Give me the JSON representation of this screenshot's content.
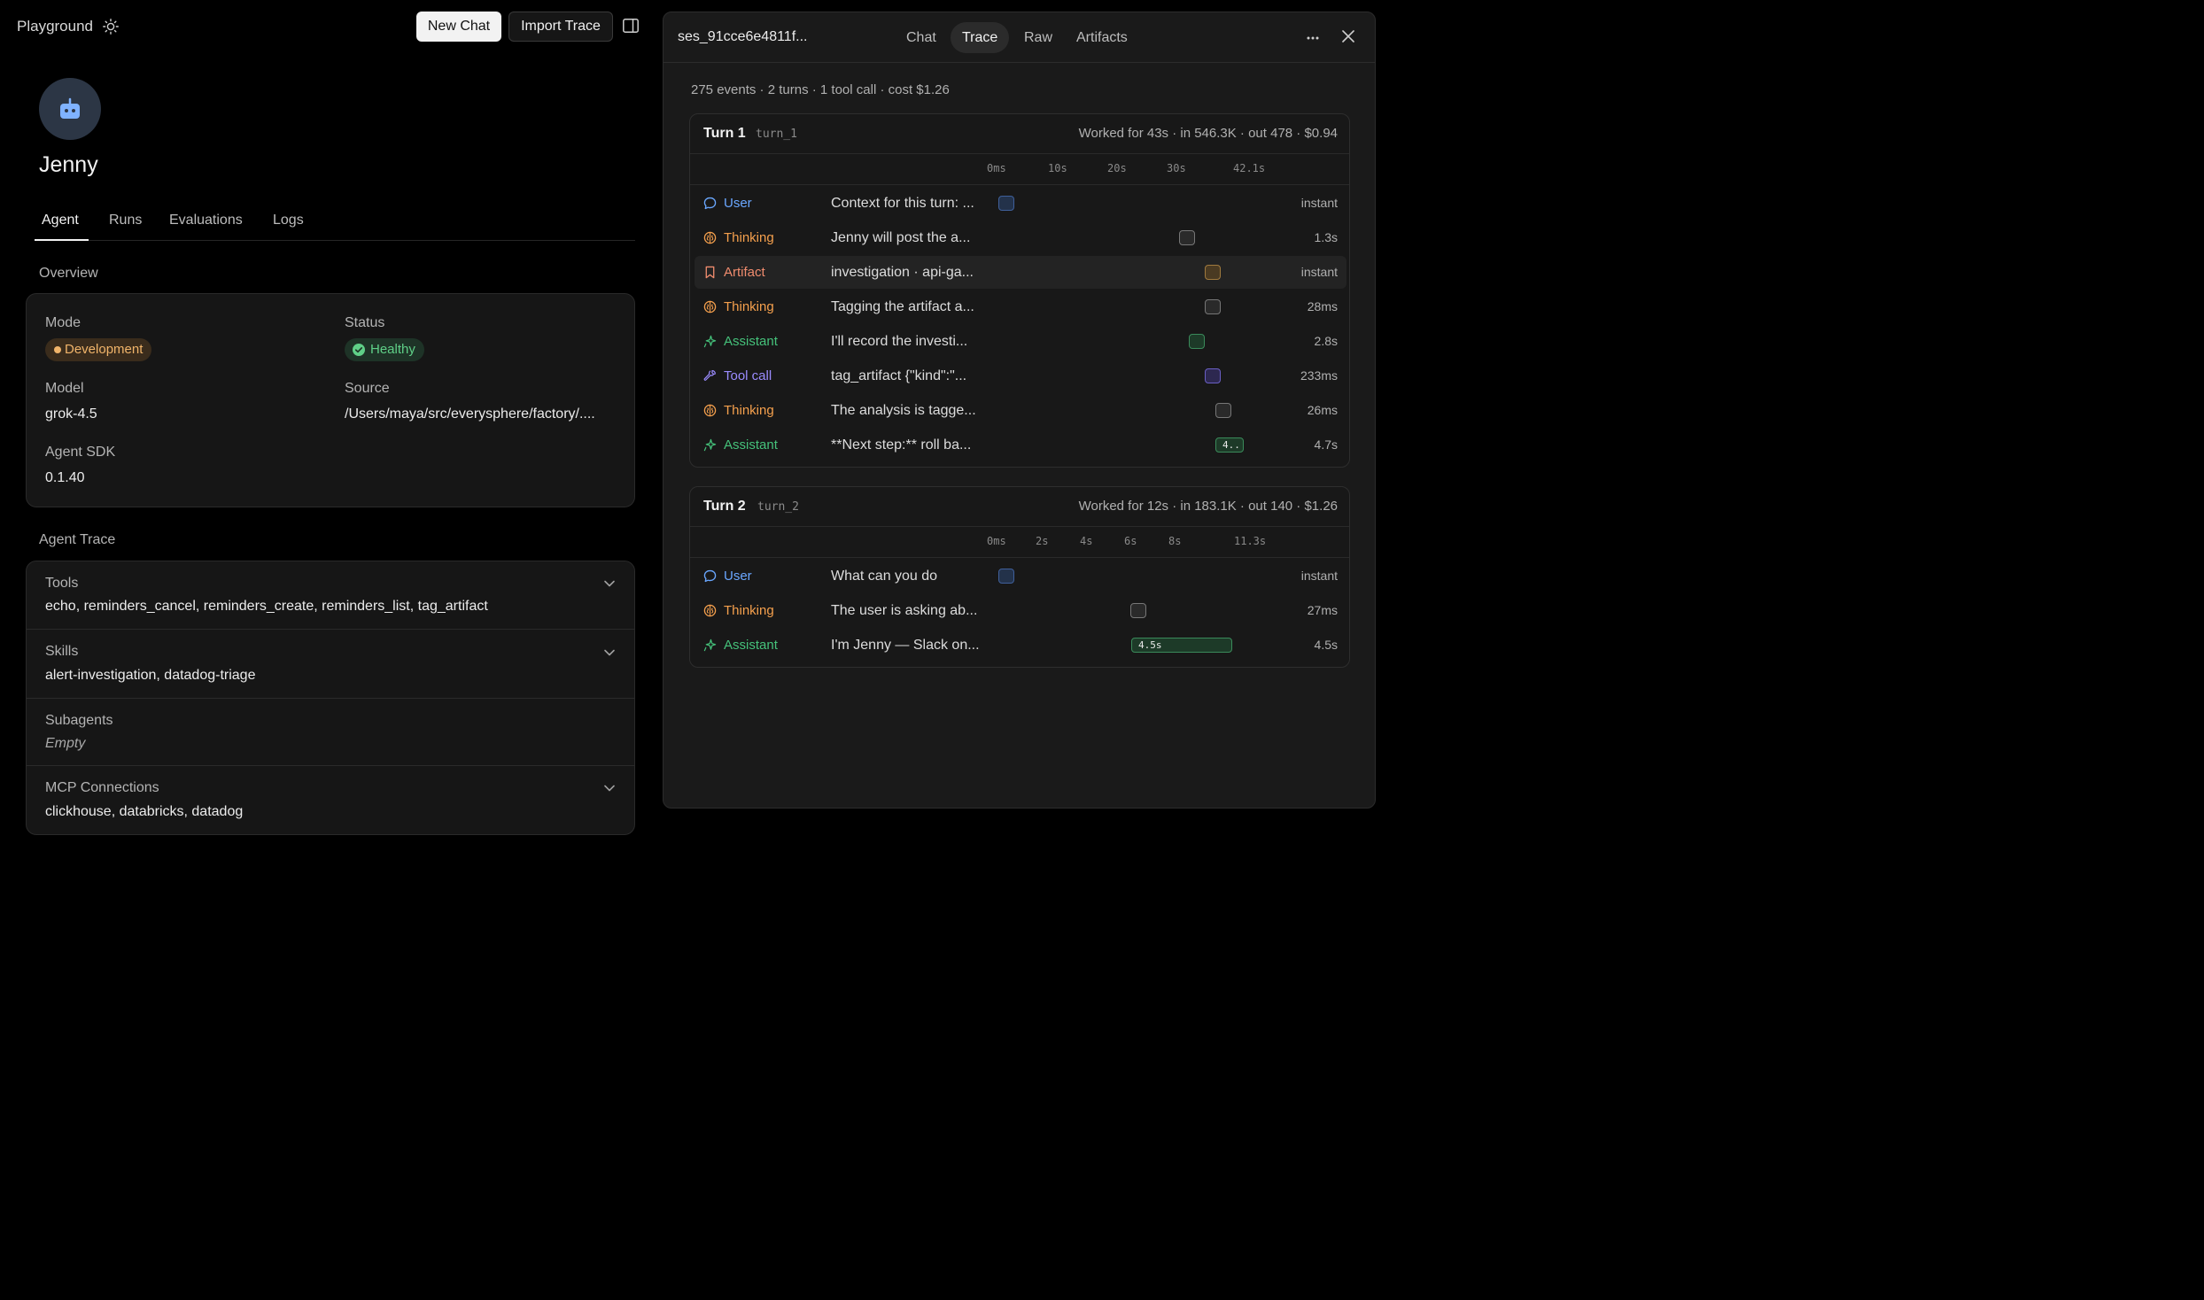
{
  "colors": {
    "user": "#6aa7ff",
    "thinking": "#f5a04d",
    "artifact": "#f08c6e",
    "assistant": "#45c17a",
    "tool_call": "#9b8cff",
    "development": "#f0b46a",
    "healthy": "#5fcf87"
  },
  "topbar": {
    "title": "Playground",
    "theme_icon": "sun-icon",
    "new_chat": "New Chat",
    "import_trace": "Import Trace",
    "panel_icon": "sidebar-toggle-icon"
  },
  "agent": {
    "avatar_icon": "robot-icon",
    "name": "Jenny",
    "tabs": [
      "Agent",
      "Runs",
      "Evaluations",
      "Logs"
    ],
    "active_tab": "Agent"
  },
  "overview": {
    "heading": "Overview",
    "mode_label": "Mode",
    "mode_value": "Development",
    "status_label": "Status",
    "status_value": "Healthy",
    "model_label": "Model",
    "model_value": "grok-4.5",
    "source_label": "Source",
    "source_value": "/Users/maya/src/everysphere/factory/....",
    "sdk_label": "Agent SDK",
    "sdk_value": "0.1.40"
  },
  "agent_trace": {
    "heading": "Agent Trace",
    "tools_label": "Tools",
    "tools_value": "echo, reminders_cancel, reminders_create, reminders_list, tag_artifact",
    "skills_label": "Skills",
    "skills_value": "alert-investigation, datadog-triage",
    "subagents_label": "Subagents",
    "subagents_value": "Empty",
    "mcp_label": "MCP Connections",
    "mcp_value": "clickhouse, databricks, datadog"
  },
  "session": {
    "id": "ses_91cce6e4811f...",
    "tabs": [
      "Chat",
      "Trace",
      "Raw",
      "Artifacts"
    ],
    "active_tab": "Trace",
    "summary": "275 events · 2 turns · 1 tool call · cost $1.26"
  },
  "turns": [
    {
      "title": "Turn 1",
      "id": "turn_1",
      "meta": "Worked for 43s · in 546.3K · out 478 · $0.94",
      "ticks": [
        "0ms",
        "10s",
        "20s",
        "30s",
        "42.1s"
      ],
      "rows": [
        {
          "kind": "User",
          "text": "Context for this turn: ...",
          "duration": "instant",
          "bar_label": ""
        },
        {
          "kind": "Thinking",
          "text": "Jenny will post the a...",
          "duration": "1.3s",
          "bar_label": ""
        },
        {
          "kind": "Artifact",
          "text": "investigation · api-ga...",
          "duration": "instant",
          "bar_label": ""
        },
        {
          "kind": "Thinking",
          "text": "Tagging the artifact a...",
          "duration": "28ms",
          "bar_label": ""
        },
        {
          "kind": "Assistant",
          "text": "I'll record the investi...",
          "duration": "2.8s",
          "bar_label": ""
        },
        {
          "kind": "Tool call",
          "text": "tag_artifact {\"kind\":\"...",
          "duration": "233ms",
          "bar_label": ""
        },
        {
          "kind": "Thinking",
          "text": "The analysis is tagge...",
          "duration": "26ms",
          "bar_label": ""
        },
        {
          "kind": "Assistant",
          "text": "**Next step:** roll ba...",
          "duration": "4.7s",
          "bar_label": "4.."
        }
      ]
    },
    {
      "title": "Turn 2",
      "id": "turn_2",
      "meta": "Worked for 12s · in 183.1K · out 140 · $1.26",
      "ticks": [
        "0ms",
        "2s",
        "4s",
        "6s",
        "8s",
        "11.3s"
      ],
      "rows": [
        {
          "kind": "User",
          "text": "What can you do",
          "duration": "instant",
          "bar_label": ""
        },
        {
          "kind": "Thinking",
          "text": "The user is asking ab...",
          "duration": "27ms",
          "bar_label": ""
        },
        {
          "kind": "Assistant",
          "text": "I'm Jenny — Slack on...",
          "duration": "4.5s",
          "bar_label": "4.5s"
        }
      ]
    }
  ]
}
